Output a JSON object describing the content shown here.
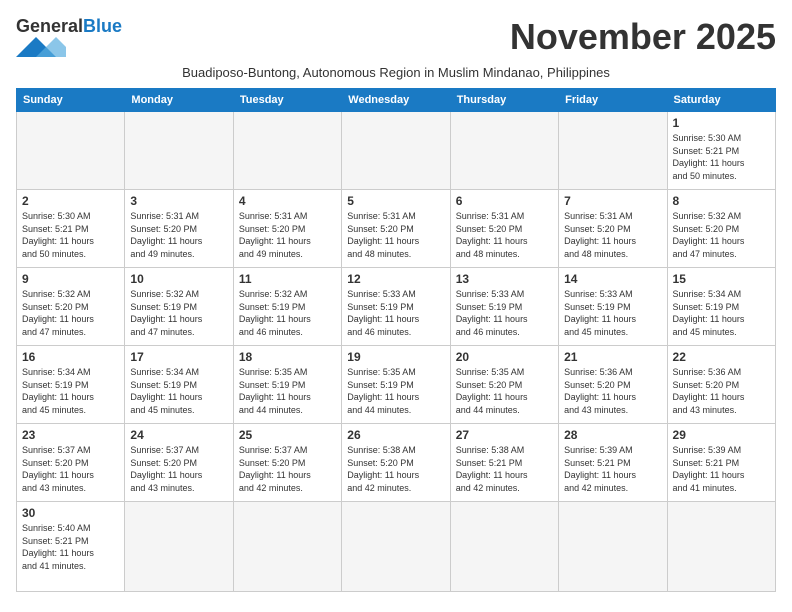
{
  "header": {
    "logo_general": "General",
    "logo_blue": "Blue",
    "month_title": "November 2025",
    "subtitle": "Buadiposo-Buntong, Autonomous Region in Muslim Mindanao, Philippines"
  },
  "weekdays": [
    "Sunday",
    "Monday",
    "Tuesday",
    "Wednesday",
    "Thursday",
    "Friday",
    "Saturday"
  ],
  "weeks": [
    [
      {
        "day": "",
        "info": ""
      },
      {
        "day": "",
        "info": ""
      },
      {
        "day": "",
        "info": ""
      },
      {
        "day": "",
        "info": ""
      },
      {
        "day": "",
        "info": ""
      },
      {
        "day": "",
        "info": ""
      },
      {
        "day": "1",
        "info": "Sunrise: 5:30 AM\nSunset: 5:21 PM\nDaylight: 11 hours\nand 50 minutes."
      }
    ],
    [
      {
        "day": "2",
        "info": "Sunrise: 5:30 AM\nSunset: 5:21 PM\nDaylight: 11 hours\nand 50 minutes."
      },
      {
        "day": "3",
        "info": "Sunrise: 5:31 AM\nSunset: 5:20 PM\nDaylight: 11 hours\nand 49 minutes."
      },
      {
        "day": "4",
        "info": "Sunrise: 5:31 AM\nSunset: 5:20 PM\nDaylight: 11 hours\nand 49 minutes."
      },
      {
        "day": "5",
        "info": "Sunrise: 5:31 AM\nSunset: 5:20 PM\nDaylight: 11 hours\nand 48 minutes."
      },
      {
        "day": "6",
        "info": "Sunrise: 5:31 AM\nSunset: 5:20 PM\nDaylight: 11 hours\nand 48 minutes."
      },
      {
        "day": "7",
        "info": "Sunrise: 5:31 AM\nSunset: 5:20 PM\nDaylight: 11 hours\nand 48 minutes."
      },
      {
        "day": "8",
        "info": "Sunrise: 5:32 AM\nSunset: 5:20 PM\nDaylight: 11 hours\nand 47 minutes."
      }
    ],
    [
      {
        "day": "9",
        "info": "Sunrise: 5:32 AM\nSunset: 5:20 PM\nDaylight: 11 hours\nand 47 minutes."
      },
      {
        "day": "10",
        "info": "Sunrise: 5:32 AM\nSunset: 5:19 PM\nDaylight: 11 hours\nand 47 minutes."
      },
      {
        "day": "11",
        "info": "Sunrise: 5:32 AM\nSunset: 5:19 PM\nDaylight: 11 hours\nand 46 minutes."
      },
      {
        "day": "12",
        "info": "Sunrise: 5:33 AM\nSunset: 5:19 PM\nDaylight: 11 hours\nand 46 minutes."
      },
      {
        "day": "13",
        "info": "Sunrise: 5:33 AM\nSunset: 5:19 PM\nDaylight: 11 hours\nand 46 minutes."
      },
      {
        "day": "14",
        "info": "Sunrise: 5:33 AM\nSunset: 5:19 PM\nDaylight: 11 hours\nand 45 minutes."
      },
      {
        "day": "15",
        "info": "Sunrise: 5:34 AM\nSunset: 5:19 PM\nDaylight: 11 hours\nand 45 minutes."
      }
    ],
    [
      {
        "day": "16",
        "info": "Sunrise: 5:34 AM\nSunset: 5:19 PM\nDaylight: 11 hours\nand 45 minutes."
      },
      {
        "day": "17",
        "info": "Sunrise: 5:34 AM\nSunset: 5:19 PM\nDaylight: 11 hours\nand 45 minutes."
      },
      {
        "day": "18",
        "info": "Sunrise: 5:35 AM\nSunset: 5:19 PM\nDaylight: 11 hours\nand 44 minutes."
      },
      {
        "day": "19",
        "info": "Sunrise: 5:35 AM\nSunset: 5:19 PM\nDaylight: 11 hours\nand 44 minutes."
      },
      {
        "day": "20",
        "info": "Sunrise: 5:35 AM\nSunset: 5:20 PM\nDaylight: 11 hours\nand 44 minutes."
      },
      {
        "day": "21",
        "info": "Sunrise: 5:36 AM\nSunset: 5:20 PM\nDaylight: 11 hours\nand 43 minutes."
      },
      {
        "day": "22",
        "info": "Sunrise: 5:36 AM\nSunset: 5:20 PM\nDaylight: 11 hours\nand 43 minutes."
      }
    ],
    [
      {
        "day": "23",
        "info": "Sunrise: 5:37 AM\nSunset: 5:20 PM\nDaylight: 11 hours\nand 43 minutes."
      },
      {
        "day": "24",
        "info": "Sunrise: 5:37 AM\nSunset: 5:20 PM\nDaylight: 11 hours\nand 43 minutes."
      },
      {
        "day": "25",
        "info": "Sunrise: 5:37 AM\nSunset: 5:20 PM\nDaylight: 11 hours\nand 42 minutes."
      },
      {
        "day": "26",
        "info": "Sunrise: 5:38 AM\nSunset: 5:20 PM\nDaylight: 11 hours\nand 42 minutes."
      },
      {
        "day": "27",
        "info": "Sunrise: 5:38 AM\nSunset: 5:21 PM\nDaylight: 11 hours\nand 42 minutes."
      },
      {
        "day": "28",
        "info": "Sunrise: 5:39 AM\nSunset: 5:21 PM\nDaylight: 11 hours\nand 42 minutes."
      },
      {
        "day": "29",
        "info": "Sunrise: 5:39 AM\nSunset: 5:21 PM\nDaylight: 11 hours\nand 41 minutes."
      }
    ],
    [
      {
        "day": "30",
        "info": "Sunrise: 5:40 AM\nSunset: 5:21 PM\nDaylight: 11 hours\nand 41 minutes."
      },
      {
        "day": "",
        "info": ""
      },
      {
        "day": "",
        "info": ""
      },
      {
        "day": "",
        "info": ""
      },
      {
        "day": "",
        "info": ""
      },
      {
        "day": "",
        "info": ""
      },
      {
        "day": "",
        "info": ""
      }
    ]
  ]
}
